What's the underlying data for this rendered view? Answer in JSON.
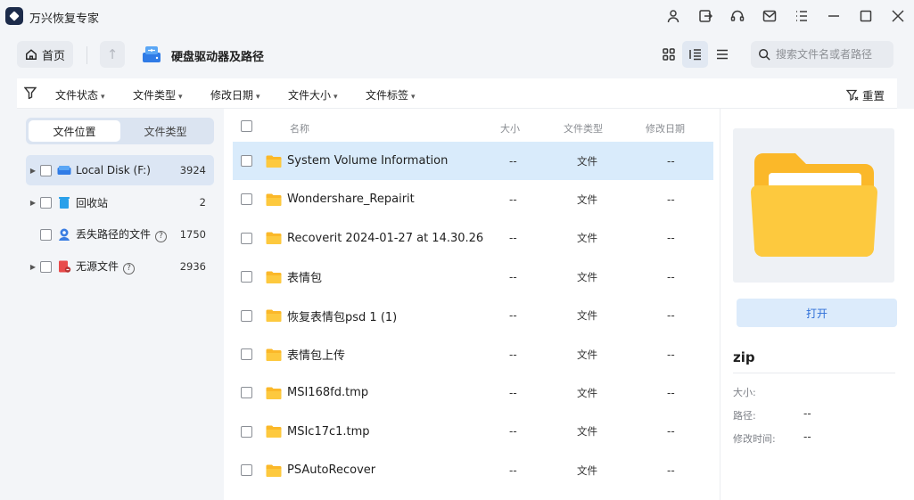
{
  "app": {
    "title": "万兴恢复专家"
  },
  "titlebar": {
    "icons": [
      "user-icon",
      "logout-icon",
      "headset-icon",
      "mail-icon",
      "menu-list-icon",
      "minimize-icon",
      "maximize-icon",
      "close-icon"
    ]
  },
  "nav": {
    "home_label": "首页",
    "path_title": "硬盘驱动器及路径",
    "search_placeholder": "搜索文件名或者路径"
  },
  "filters": {
    "items": [
      "文件状态",
      "文件类型",
      "修改日期",
      "文件大小",
      "文件标签"
    ],
    "reset_label": "重置"
  },
  "sidebar": {
    "tabs": [
      "文件位置",
      "文件类型"
    ],
    "items": [
      {
        "label": "Local Disk (F:)",
        "count": "3924",
        "icon": "drive-icon"
      },
      {
        "label": "回收站",
        "count": "2",
        "icon": "trash-icon"
      },
      {
        "label": "丢失路径的文件",
        "count": "1750",
        "icon": "lost-file-icon"
      },
      {
        "label": "无源文件",
        "count": "2936",
        "icon": "sourceless-file-icon"
      }
    ]
  },
  "file_list": {
    "columns": {
      "name": "名称",
      "size": "大小",
      "type": "文件类型",
      "date": "修改日期"
    },
    "rows": [
      {
        "name": "System Volume Information",
        "size": "--",
        "type": "文件",
        "date": "--"
      },
      {
        "name": "Wondershare_Repairit",
        "size": "--",
        "type": "文件",
        "date": "--"
      },
      {
        "name": "Recoverit 2024-01-27 at 14.30.26",
        "size": "--",
        "type": "文件",
        "date": "--"
      },
      {
        "name": "表情包",
        "size": "--",
        "type": "文件",
        "date": "--"
      },
      {
        "name": "恢复表情包psd 1 (1)",
        "size": "--",
        "type": "文件",
        "date": "--"
      },
      {
        "name": "表情包上传",
        "size": "--",
        "type": "文件",
        "date": "--"
      },
      {
        "name": "MSI168fd.tmp",
        "size": "--",
        "type": "文件",
        "date": "--"
      },
      {
        "name": "MSIc17c1.tmp",
        "size": "--",
        "type": "文件",
        "date": "--"
      },
      {
        "name": "PSAutoRecover",
        "size": "--",
        "type": "文件",
        "date": "--"
      }
    ]
  },
  "preview": {
    "open_label": "打开",
    "name": "zip",
    "fields": [
      {
        "label": "大小:",
        "value": ""
      },
      {
        "label": "路径:",
        "value": "--"
      },
      {
        "label": "修改时间:",
        "value": "--"
      }
    ]
  },
  "colors": {
    "accent": "#2f6fd8",
    "selected_row": "#d9ebfb",
    "folder": "#fbb829"
  }
}
